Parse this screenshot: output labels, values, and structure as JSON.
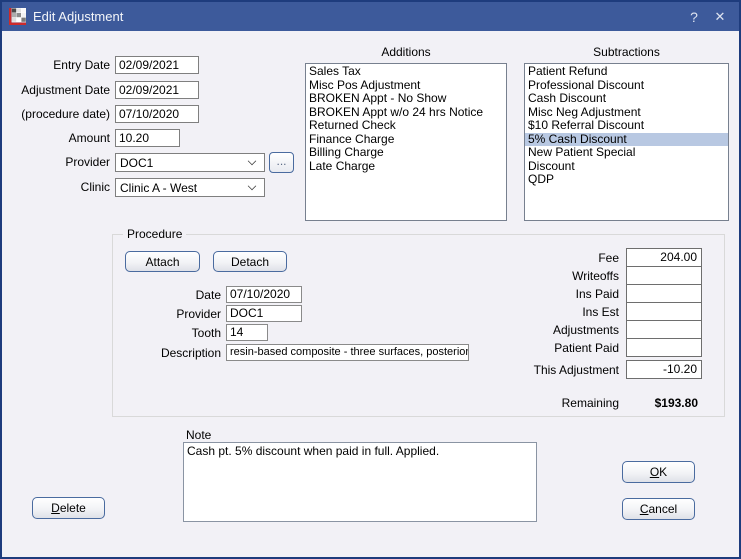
{
  "window": {
    "title": "Edit Adjustment",
    "help_glyph": "?",
    "close_glyph": "✕"
  },
  "fields": {
    "entry_date": {
      "label": "Entry Date",
      "value": "02/09/2021"
    },
    "adjustment_date": {
      "label": "Adjustment Date",
      "value": "02/09/2021"
    },
    "procedure_date": {
      "label": "(procedure date)",
      "value": "07/10/2020"
    },
    "amount": {
      "label": "Amount",
      "value": "10.20"
    },
    "provider": {
      "label": "Provider",
      "value": "DOC1",
      "more_label": "..."
    },
    "clinic": {
      "label": "Clinic",
      "value": "Clinic A - West"
    }
  },
  "additions": {
    "title": "Additions",
    "items": [
      "Sales Tax",
      "Misc Pos Adjustment",
      "BROKEN Appt - No Show",
      "BROKEN Appt w/o 24 hrs Notice",
      "Returned Check",
      "Finance Charge",
      "Billing Charge",
      "Late Charge"
    ],
    "selected_index": -1
  },
  "subtractions": {
    "title": "Subtractions",
    "items": [
      "Patient Refund",
      "Professional Discount",
      "Cash Discount",
      "Misc Neg Adjustment",
      "$10 Referral Discount",
      "5% Cash Discount",
      "New Patient Special",
      "Discount",
      "QDP"
    ],
    "selected_index": 5
  },
  "procedure": {
    "title": "Procedure",
    "attach_label": "Attach",
    "detach_label": "Detach",
    "date": {
      "label": "Date",
      "value": "07/10/2020"
    },
    "provider": {
      "label": "Provider",
      "value": "DOC1"
    },
    "tooth": {
      "label": "Tooth",
      "value": "14"
    },
    "description": {
      "label": "Description",
      "value": "resin-based composite - three surfaces, posterior"
    },
    "amounts": [
      {
        "label": "Fee",
        "value": "204.00"
      },
      {
        "label": "Writeoffs",
        "value": ""
      },
      {
        "label": "Ins Paid",
        "value": ""
      },
      {
        "label": "Ins Est",
        "value": ""
      },
      {
        "label": "Adjustments",
        "value": ""
      },
      {
        "label": "Patient Paid",
        "value": ""
      },
      {
        "label": "This Adjustment",
        "value": "-10.20"
      }
    ],
    "remaining": {
      "label": "Remaining",
      "value": "$193.80"
    }
  },
  "note": {
    "label": "Note",
    "value": "Cash pt. 5% discount when paid in full. Applied."
  },
  "buttons": {
    "delete": {
      "accel": "D",
      "rest": "elete"
    },
    "ok": {
      "accel": "O",
      "rest": "K"
    },
    "cancel": {
      "accel": "C",
      "rest": "ancel"
    }
  },
  "colors": {
    "titlebar": "#3D5A9B",
    "dialog_border": "#1E3C7D",
    "background": "#F2F1F6",
    "selection": "#B8C8E2",
    "button_border": "#4A6B9F",
    "accent_red": "#CE2B2B"
  }
}
